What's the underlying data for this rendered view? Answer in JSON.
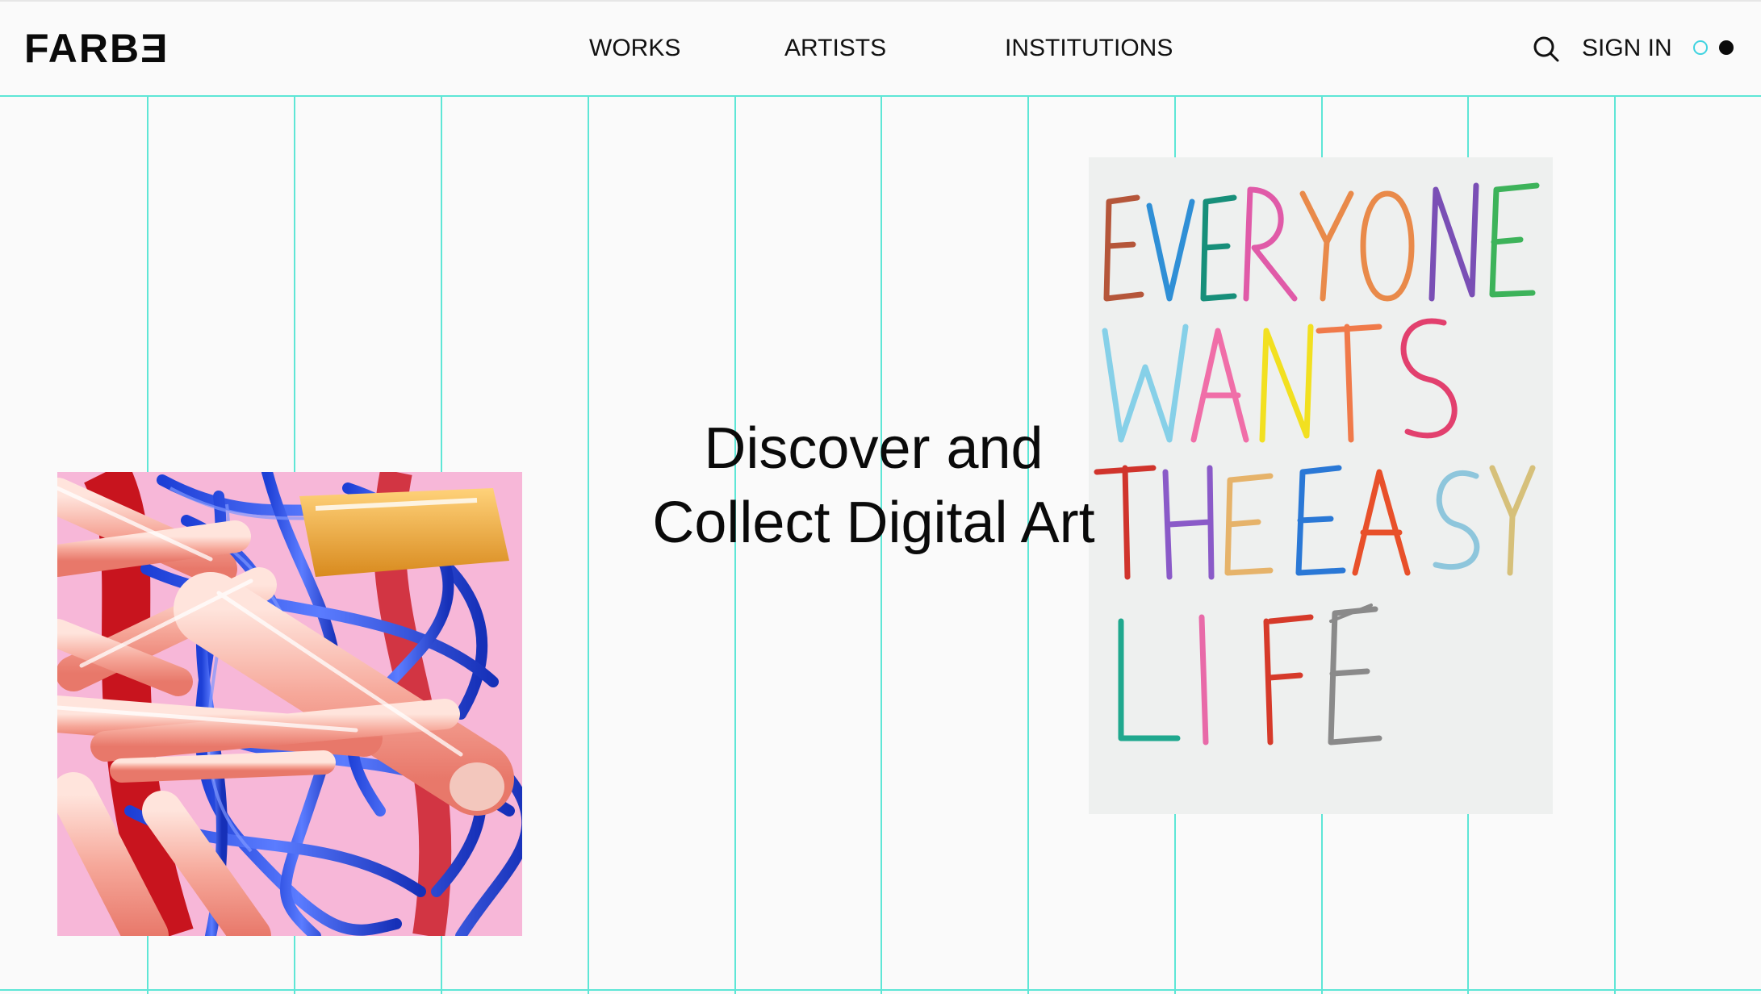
{
  "brand": {
    "logo": "FARBƎ"
  },
  "nav": {
    "items": [
      "WORKS",
      "ARTISTS",
      "INSTITUTIONS"
    ],
    "sign_in": "SIGN IN",
    "search_icon": "search-icon",
    "theme_toggle": "theme-toggle-icon"
  },
  "hero": {
    "line1": "Discover and",
    "line2": "Collect Digital Art"
  },
  "artworks": {
    "left": {
      "icon": "abstract-3d-artwork"
    },
    "right": {
      "icon": "handwritten-text-artwork",
      "lines": [
        "EVERYONE",
        "WANTS",
        "THE EASY",
        "LIFE"
      ]
    }
  },
  "colors": {
    "accent": "#5ee6d6",
    "toggle_ring": "#3fd3e0",
    "text": "#0a0a0a",
    "background": "#fafafa"
  }
}
